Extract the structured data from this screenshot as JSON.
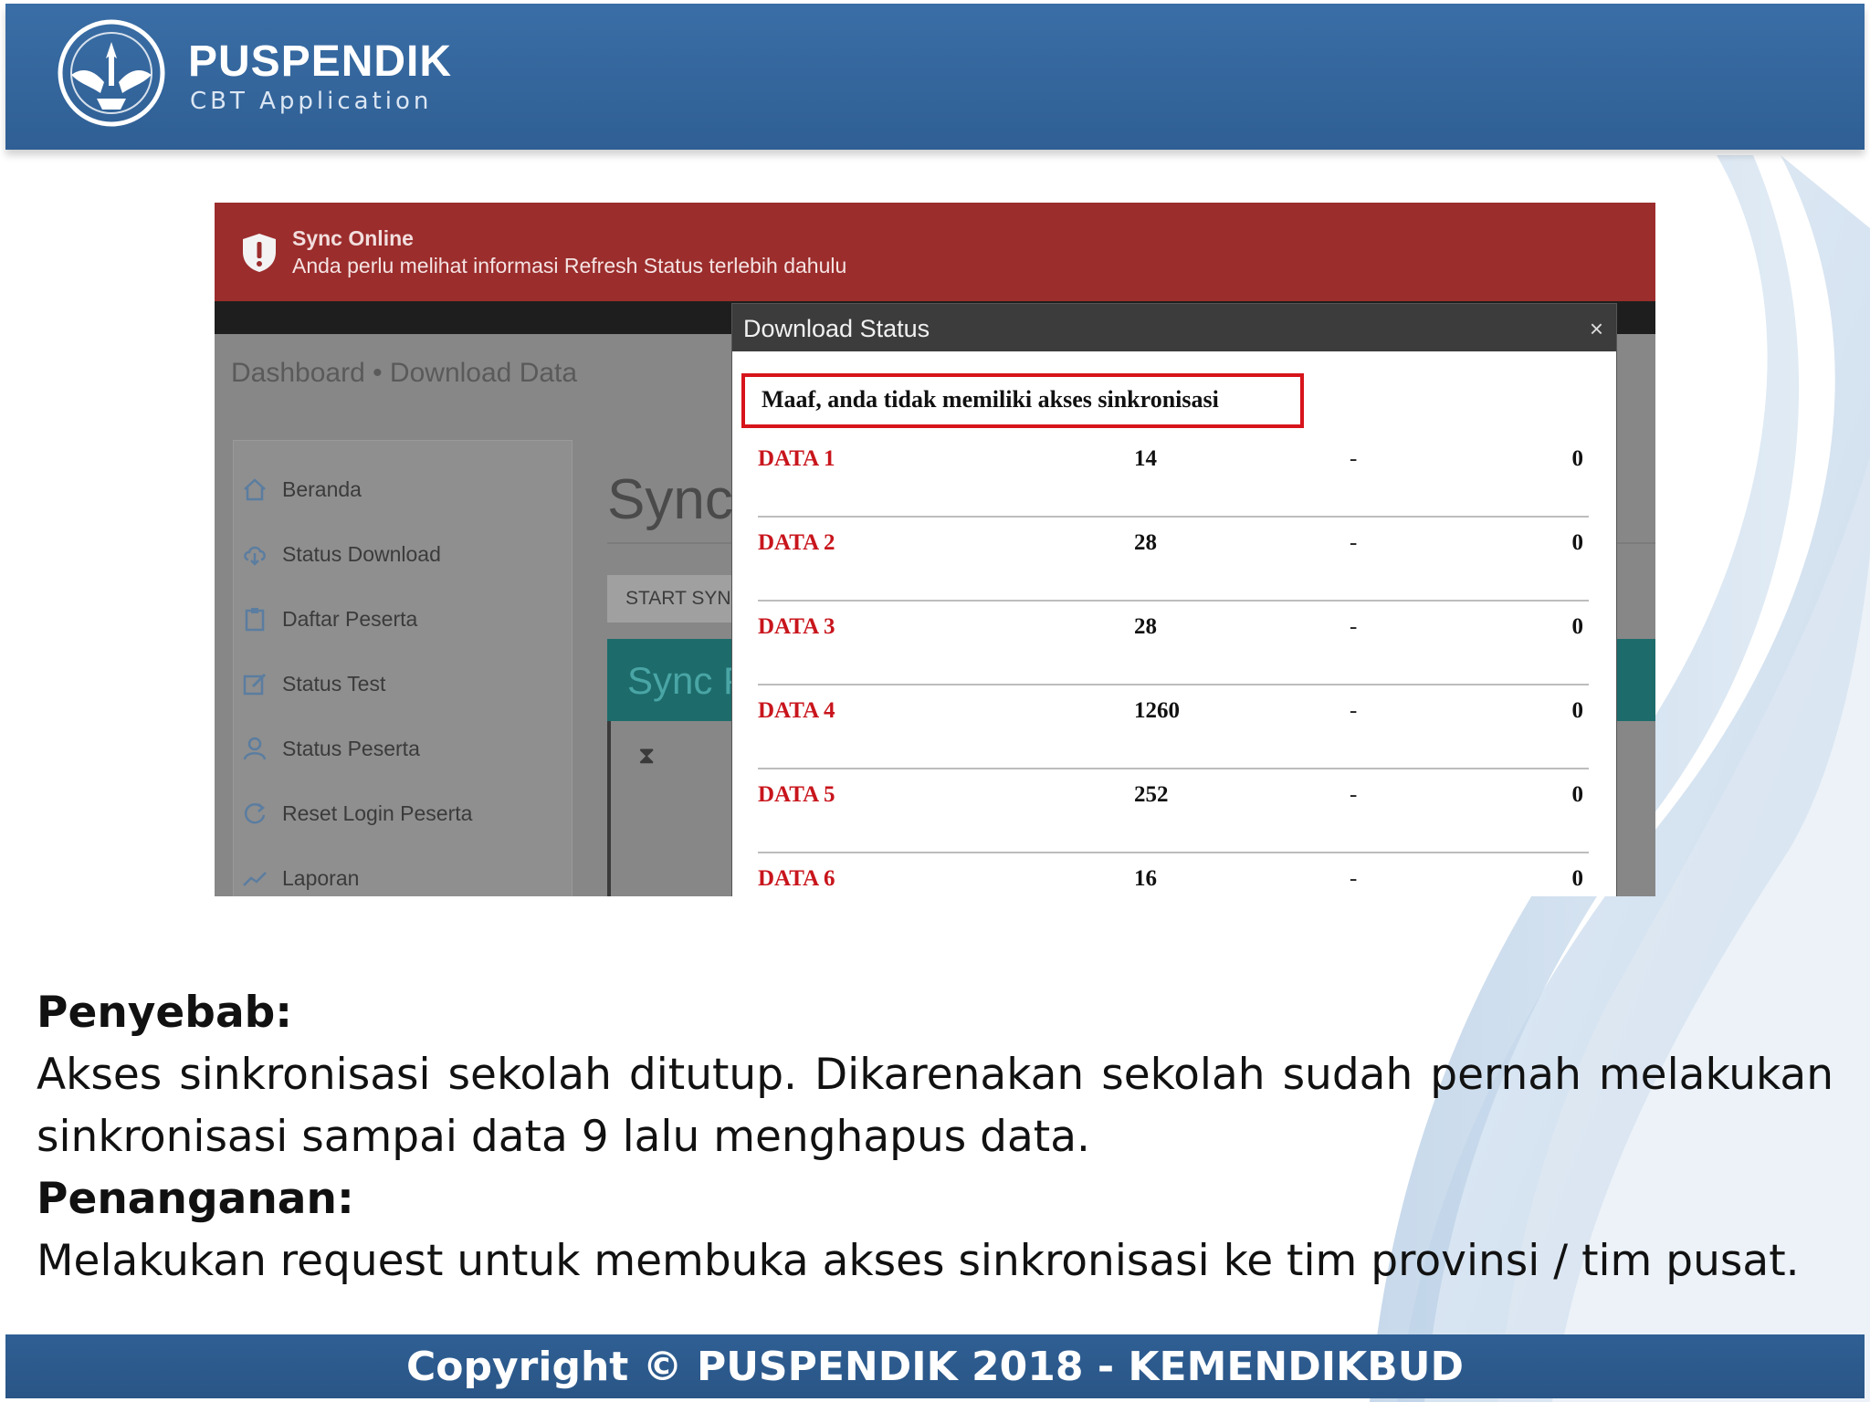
{
  "header": {
    "brand_name": "PUSPENDIK",
    "brand_sub": "CBT Application",
    "logo_icon": "tut-wuri-handayani-emblem-icon"
  },
  "screenshot": {
    "alert": {
      "title": "Sync Online",
      "message": "Anda perlu melihat informasi Refresh Status terlebih dahulu",
      "icon": "shield-alert-icon"
    },
    "breadcrumb": "Dashboard • Download Data",
    "sidebar": [
      {
        "label": "Beranda",
        "icon": "home-icon"
      },
      {
        "label": "Status Download",
        "icon": "cloud-download-icon"
      },
      {
        "label": "Daftar Peserta",
        "icon": "clipboard-icon"
      },
      {
        "label": "Status Test",
        "icon": "edit-icon"
      },
      {
        "label": "Status Peserta",
        "icon": "user-icon"
      },
      {
        "label": "Reset Login Peserta",
        "icon": "refresh-icon"
      },
      {
        "label": "Laporan",
        "icon": "chart-line-icon"
      }
    ],
    "sync_title": "Sync",
    "start_sync_label": "START SYNC",
    "teal_panel_text": "Sync P",
    "modal": {
      "title": "Download Status",
      "close": "×",
      "error": "Maaf, anda tidak memiliki akses sinkronisasi",
      "rows": [
        {
          "name": "DATA 1",
          "count": "14",
          "dash": "-",
          "value": "0"
        },
        {
          "name": "DATA 2",
          "count": "28",
          "dash": "-",
          "value": "0"
        },
        {
          "name": "DATA 3",
          "count": "28",
          "dash": "-",
          "value": "0"
        },
        {
          "name": "DATA 4",
          "count": "1260",
          "dash": "-",
          "value": "0"
        },
        {
          "name": "DATA 5",
          "count": "252",
          "dash": "-",
          "value": "0"
        },
        {
          "name": "DATA 6",
          "count": "16",
          "dash": "-",
          "value": "0"
        }
      ]
    }
  },
  "content": {
    "cause_heading": "Penyebab:",
    "cause_text": "Akses sinkronisasi sekolah ditutup. Dikarenakan sekolah sudah pernah melakukan sinkronisasi sampai data 9 lalu menghapus data.",
    "fix_heading": "Penanganan:",
    "fix_text": "Melakukan request untuk membuka akses sinkronisasi ke tim provinsi / tim pusat."
  },
  "footer": {
    "text": "Copyright © PUSPENDIK 2018 - KEMENDIKBUD"
  },
  "colors": {
    "header_blue": "#336699",
    "alert_red": "#9b2d2c",
    "error_border": "#d7141b",
    "data_label_red": "#c8151c"
  }
}
